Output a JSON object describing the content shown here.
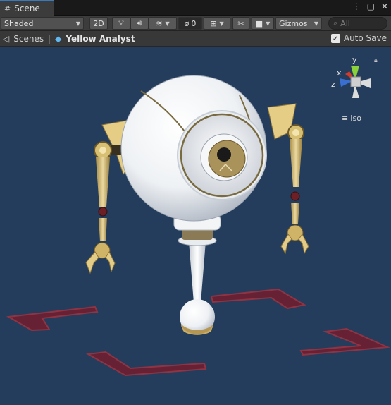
{
  "tab": {
    "title": "Scene",
    "icon": "grid-icon"
  },
  "window_controls": [
    "kebab-menu-icon",
    "maximize-icon",
    "close-icon"
  ],
  "toolbar": {
    "shading_mode": "Shaded",
    "mode_2d": "2D",
    "hidden_count": "0",
    "gizmos_label": "Gizmos",
    "search_placeholder": "All"
  },
  "breadcrumb": {
    "root": "Scenes",
    "object": "Yellow Analyst"
  },
  "auto_save": {
    "label": "Auto Save",
    "checked": true
  },
  "orientation_gizmo": {
    "axes": {
      "x": "x",
      "y": "y",
      "z": "z"
    },
    "projection": "Iso",
    "colors": {
      "x": "#d23a2a",
      "y": "#8ad13a",
      "z": "#3a6fd2"
    }
  },
  "colors": {
    "viewport_bg": "#243d5c",
    "floor_marker": "#7a2430",
    "robot_body": "#f2f4f6",
    "robot_gold": "#d9c27a"
  }
}
